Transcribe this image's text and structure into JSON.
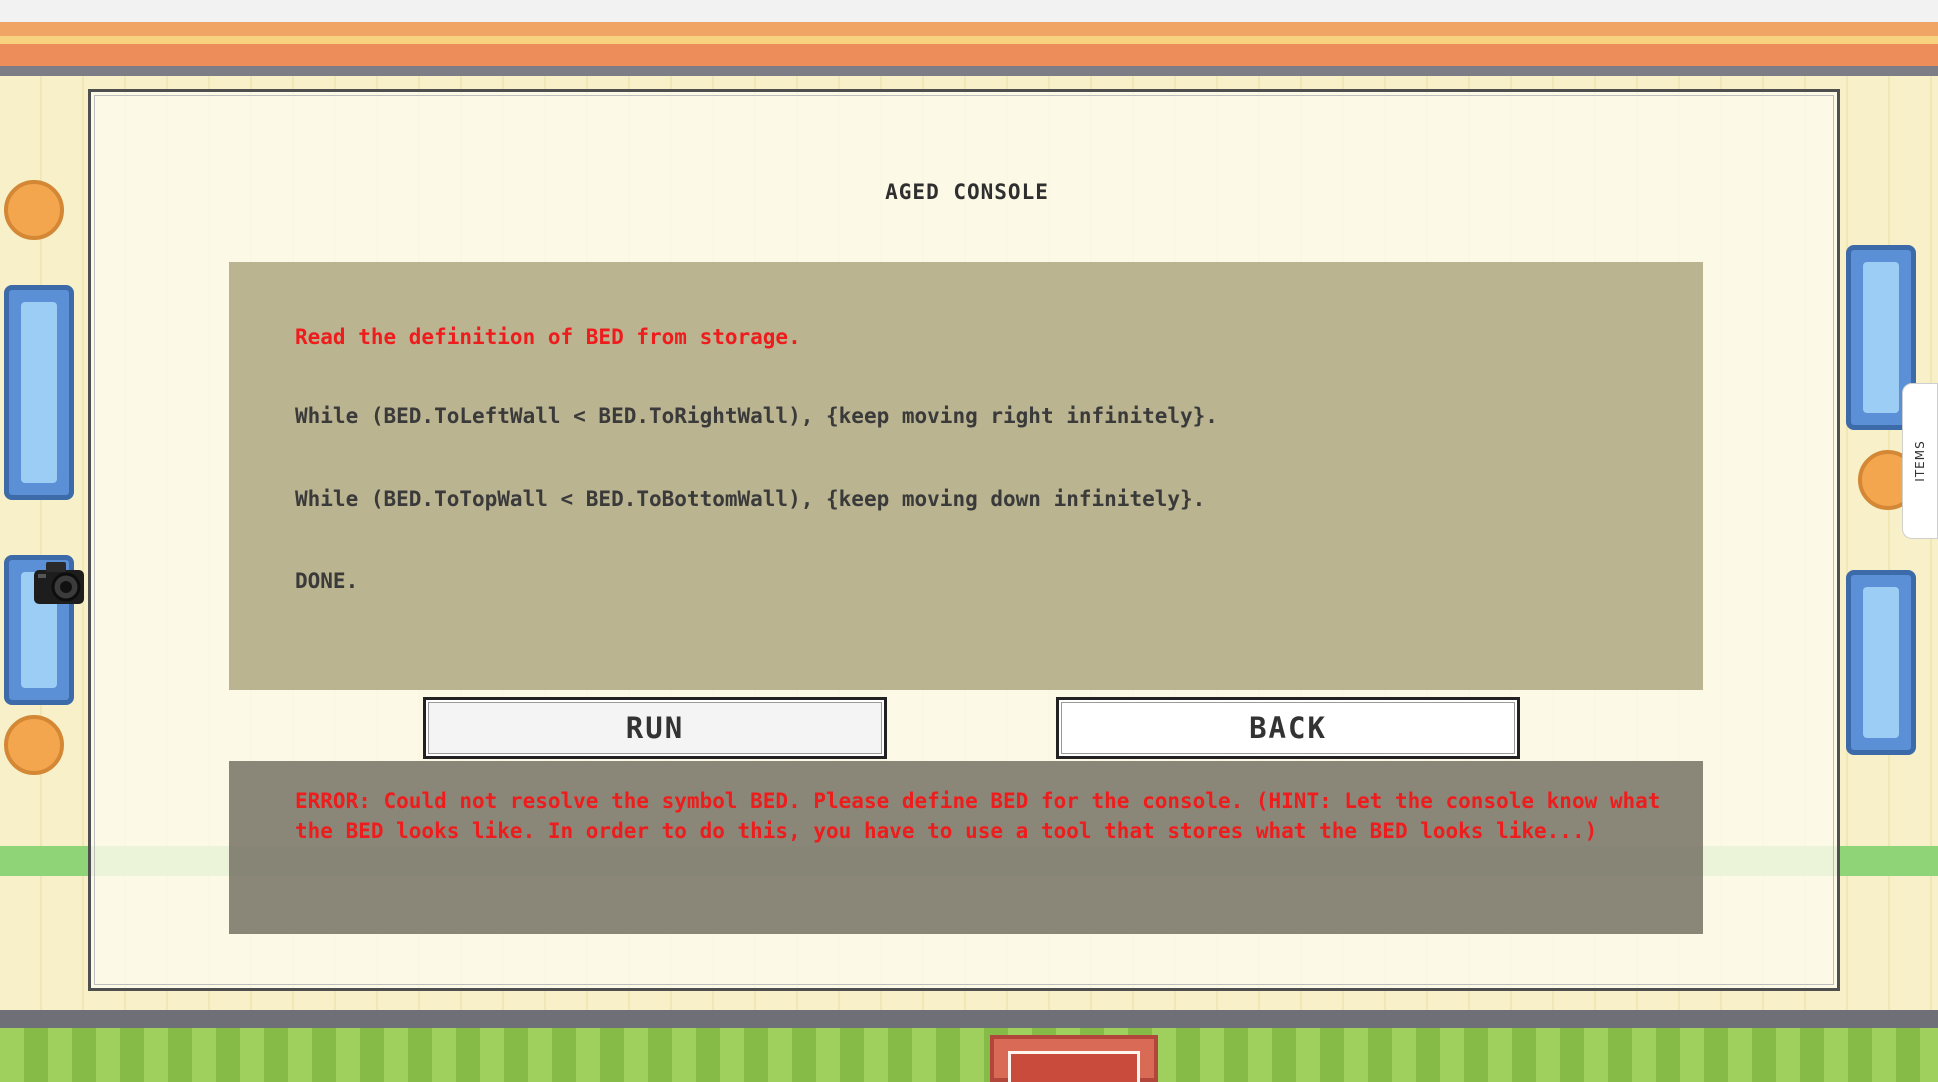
{
  "side_tab": {
    "label": "ITEMS"
  },
  "console": {
    "title": "AGED CONSOLE",
    "code_lines": [
      "Read the definition of BED from storage.",
      "While (BED.ToLeftWall < BED.ToRightWall), {keep moving right infinitely}.",
      "While (BED.ToTopWall < BED.ToBottomWall), {keep moving down infinitely}.",
      "DONE."
    ],
    "run_label": "RUN",
    "back_label": "BACK",
    "error": "ERROR: Could not resolve the symbol BED. Please define BED for the console. (HINT: Let the console know what the BED looks like. In order to do this, you have to use a tool that stores what the BED looks like...)"
  },
  "colors": {
    "error_red": "#ee1c1c",
    "code_text": "#3a3a3a",
    "code_panel": "#9b9368",
    "error_panel": "#6e6a5c"
  }
}
